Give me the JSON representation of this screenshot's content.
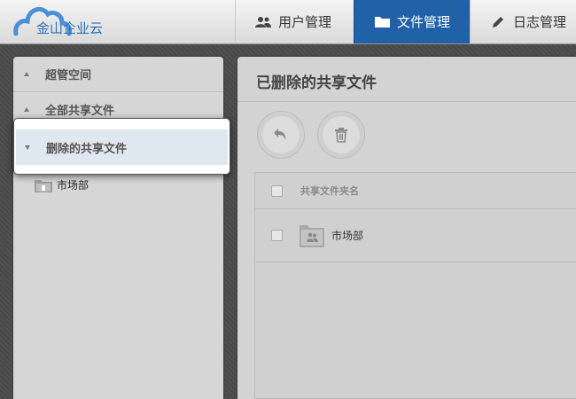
{
  "logo": {
    "text": "金山企业云"
  },
  "nav": {
    "tabs": [
      {
        "label": "用户管理",
        "icon": "users-icon"
      },
      {
        "label": "文件管理",
        "icon": "folder-icon",
        "active": true
      },
      {
        "label": "日志管理",
        "icon": "pencil-icon"
      }
    ],
    "active_color": "#2161a8"
  },
  "sidebar": {
    "items": [
      {
        "label": "超管空间"
      },
      {
        "label": "全部共享文件"
      },
      {
        "label": "删除的共享文件",
        "selected": true
      }
    ],
    "leaf": {
      "label": "市场部",
      "icon": "folder-icon"
    }
  },
  "main": {
    "title": "已删除的共享文件",
    "toolbar": {
      "restore_icon": "undo-icon",
      "delete_icon": "trash-icon"
    },
    "table": {
      "header": "共享文件夹名",
      "rows": [
        {
          "name": "市场部",
          "icon": "shared-folder-icon"
        }
      ]
    }
  }
}
